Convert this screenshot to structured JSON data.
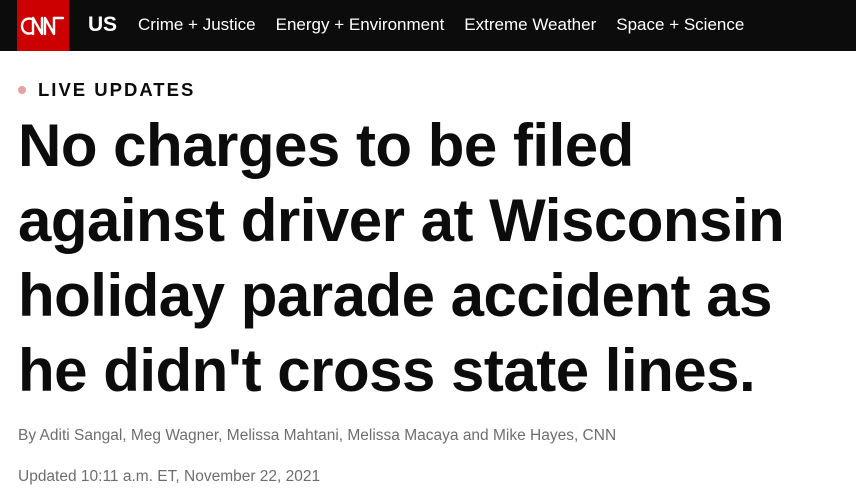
{
  "header": {
    "logo_text": "CNN",
    "section": "US",
    "nav_links": [
      "Crime + Justice",
      "Energy + Environment",
      "Extreme Weather",
      "Space + Science"
    ],
    "background_color": "#0c0c0c",
    "logo_color": "#cc0000"
  },
  "article": {
    "live_label": "LIVE UPDATES",
    "live_dot_color": "#e7a2a6",
    "headline": "No charges to be filed against driver at Wisconsin holiday parade accident as he didn't cross state lines.",
    "byline": "By Aditi Sangal, Meg Wagner, Melissa Mahtani, Melissa Macaya and Mike Hayes, CNN",
    "updated": "Updated 10:11 a.m. ET, November 22, 2021"
  }
}
